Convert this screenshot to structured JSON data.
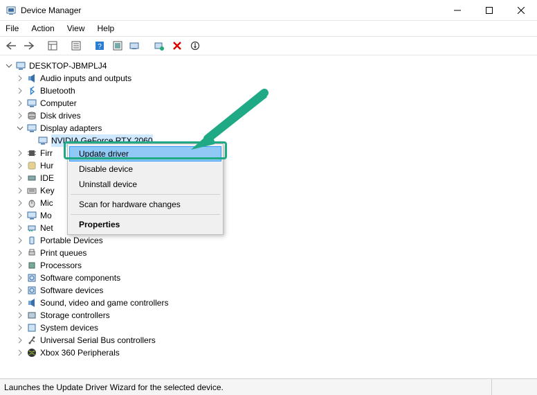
{
  "window": {
    "title": "Device Manager"
  },
  "menubar": [
    "File",
    "Action",
    "View",
    "Help"
  ],
  "status": "Launches the Update Driver Wizard for the selected device.",
  "root": "DESKTOP-JBMPLJ4",
  "categories": [
    {
      "label": "Audio inputs and outputs",
      "expanded": false,
      "icon": "speaker"
    },
    {
      "label": "Bluetooth",
      "expanded": false,
      "icon": "bt"
    },
    {
      "label": "Computer",
      "expanded": false,
      "icon": "monitor"
    },
    {
      "label": "Disk drives",
      "expanded": false,
      "icon": "disk"
    },
    {
      "label": "Display adapters",
      "expanded": true,
      "icon": "monitor",
      "children": [
        {
          "label": "NVIDIA GeForce RTX 2060",
          "icon": "monitor",
          "selected": true
        }
      ]
    },
    {
      "label": "Firmware",
      "truncated": "Firr",
      "expanded": false,
      "icon": "chip"
    },
    {
      "label": "Human Interface Devices",
      "truncated": "Hur",
      "expanded": false,
      "icon": "hid"
    },
    {
      "label": "IDE ATA/ATAPI controllers",
      "truncated": "IDE",
      "expanded": false,
      "icon": "ide"
    },
    {
      "label": "Keyboards",
      "truncated": "Key",
      "expanded": false,
      "icon": "kb"
    },
    {
      "label": "Mice and other pointing devices",
      "truncated": "Mic",
      "expanded": false,
      "icon": "mouse"
    },
    {
      "label": "Monitors",
      "truncated": "Mo",
      "expanded": false,
      "icon": "monitor"
    },
    {
      "label": "Network adapters",
      "truncated": "Net",
      "expanded": false,
      "icon": "net"
    },
    {
      "label": "Portable Devices",
      "expanded": false,
      "icon": "portable"
    },
    {
      "label": "Print queues",
      "expanded": false,
      "icon": "printer"
    },
    {
      "label": "Processors",
      "expanded": false,
      "icon": "cpu"
    },
    {
      "label": "Software components",
      "expanded": false,
      "icon": "sw"
    },
    {
      "label": "Software devices",
      "expanded": false,
      "icon": "sw"
    },
    {
      "label": "Sound, video and game controllers",
      "expanded": false,
      "icon": "speaker"
    },
    {
      "label": "Storage controllers",
      "expanded": false,
      "icon": "storage"
    },
    {
      "label": "System devices",
      "expanded": false,
      "icon": "sys"
    },
    {
      "label": "Universal Serial Bus controllers",
      "expanded": false,
      "icon": "usb"
    },
    {
      "label": "Xbox 360 Peripherals",
      "expanded": false,
      "icon": "xbox"
    }
  ],
  "context_menu": {
    "items": [
      {
        "label": "Update driver",
        "highlighted": true
      },
      {
        "label": "Disable device"
      },
      {
        "label": "Uninstall device"
      },
      {
        "sep": true
      },
      {
        "label": "Scan for hardware changes"
      },
      {
        "sep": true
      },
      {
        "label": "Properties",
        "bold": true
      }
    ]
  },
  "colors": {
    "annotation": "#1fa985",
    "selection": "#cde8ff",
    "menu_highlight": "#90c8f6"
  }
}
